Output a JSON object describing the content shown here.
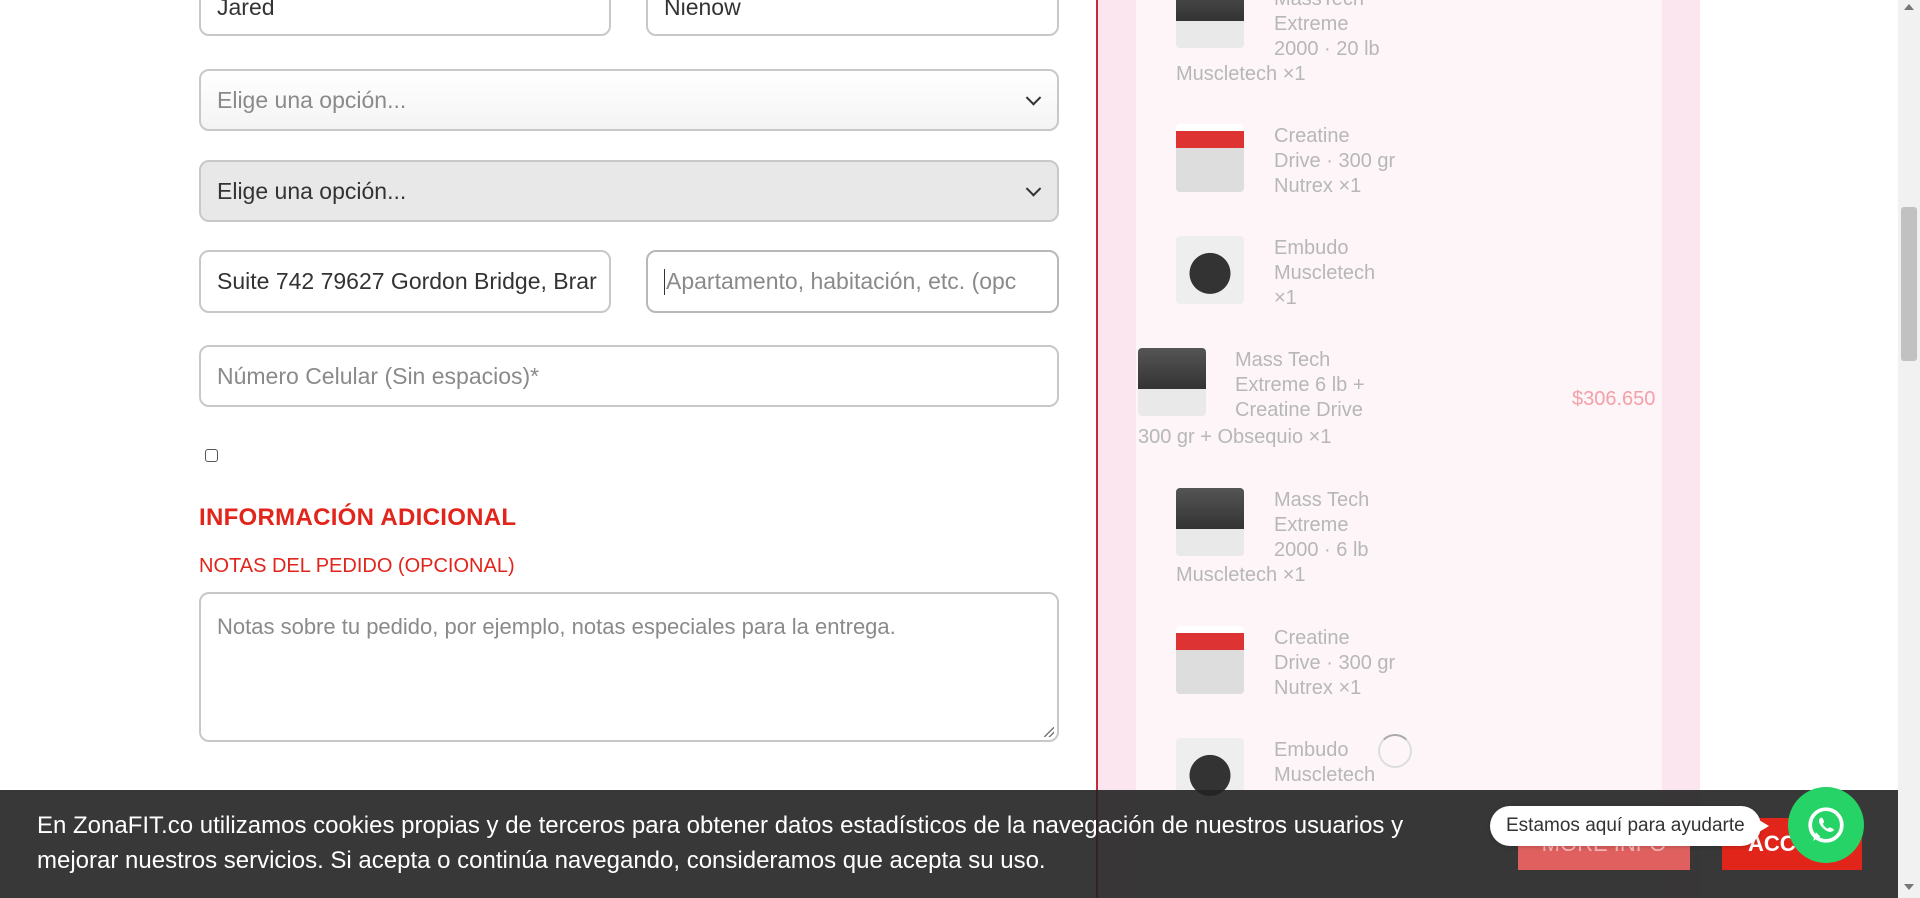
{
  "form": {
    "first_name_value": "Jared",
    "last_name_value": "Nienow",
    "select_1_placeholder": "Elige una opción...",
    "select_2_value": "Elige una opción...",
    "address_value": "Suite 742 79627 Gordon Bridge, Brar",
    "apartment_placeholder": "Apartamento, habitación, etc. (opc",
    "phone_placeholder": "Número Celular (Sin espacios)*",
    "additional_info_heading": "INFORMACIÓN ADICIONAL",
    "order_notes_label": "NOTAS DEL PEDIDO (OPCIONAL)",
    "order_notes_placeholder": "Notas sobre tu pedido, por ejemplo, notas especiales para la entrega."
  },
  "cart": {
    "items": [
      {
        "name_line1": "MassTech",
        "name_line2": "Extreme",
        "name_line3": "2000 · 20 lb",
        "brand_qty": "Muscletech  ×1"
      },
      {
        "name_line1": "Creatine",
        "name_line2": "Drive · 300 gr",
        "name_line3": "Nutrex  ×1"
      },
      {
        "name_line1": "Embudo",
        "name_line2": "Muscletech",
        "name_line3": "×1"
      },
      {
        "name_line1": "Mass Tech",
        "name_line2": "Extreme 6 lb +",
        "name_line3": "Creatine Drive",
        "name_line4": "300 gr + Obsequio  ×1",
        "price": "$306.650"
      },
      {
        "name_line1": "Mass Tech",
        "name_line2": "Extreme",
        "name_line3": "2000 · 6 lb",
        "brand_qty": "Muscletech  ×1"
      },
      {
        "name_line1": "Creatine",
        "name_line2": "Drive · 300 gr",
        "name_line3": "Nutrex  ×1"
      },
      {
        "name_line1": "Embudo",
        "name_line2": "Muscletech"
      }
    ]
  },
  "cookie": {
    "text": "En ZonaFIT.co utilizamos cookies propias y de terceros para obtener datos estadísticos de la navegación de nuestros usuarios y mejorar nuestros servicios. Si acepta o continúa navegando, consideramos que acepta su uso.",
    "more_info": "MORE INFO",
    "accept": "ACC"
  },
  "chat": {
    "bubble": "Estamos aquí para ayudarte",
    "icon": "whatsapp-icon"
  },
  "colors": {
    "accent": "#e1251b",
    "cart_bg": "#fbe6ef",
    "whatsapp": "#25d366"
  }
}
